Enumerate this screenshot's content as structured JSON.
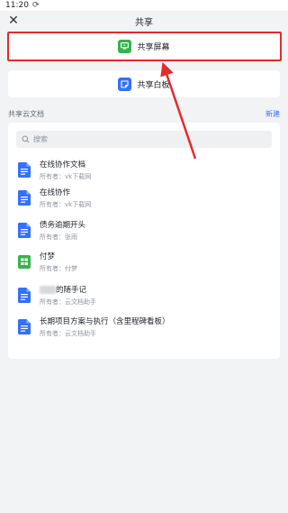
{
  "status_bar": {
    "time": "11:20"
  },
  "header": {
    "title": "共享"
  },
  "share_screen": {
    "label": "共享屏幕"
  },
  "share_board": {
    "label": "共享白板"
  },
  "section": {
    "label": "共享云文档",
    "new_label": "新建"
  },
  "search": {
    "placeholder": "搜索"
  },
  "docs": [
    {
      "name": "在线协作文档",
      "owner": "所有者：vk下载网",
      "type": "doc"
    },
    {
      "name": "在线协作",
      "owner": "所有者：vk下载网",
      "type": "doc"
    },
    {
      "name": "债务逾期开头",
      "owner": "所有者：张雨",
      "type": "doc"
    },
    {
      "name": "付梦",
      "owner": "所有者：付梦",
      "type": "sheet"
    },
    {
      "name": "的随手记",
      "owner": "所有者：云文档助手",
      "type": "doc"
    },
    {
      "name": "长期项目方案与执行（含里程碑看板）",
      "owner": "所有者：云文档助手",
      "type": "doc"
    }
  ],
  "colors": {
    "accent": "#3370ff",
    "highlight": "#e42b2b",
    "green": "#34b34a"
  }
}
